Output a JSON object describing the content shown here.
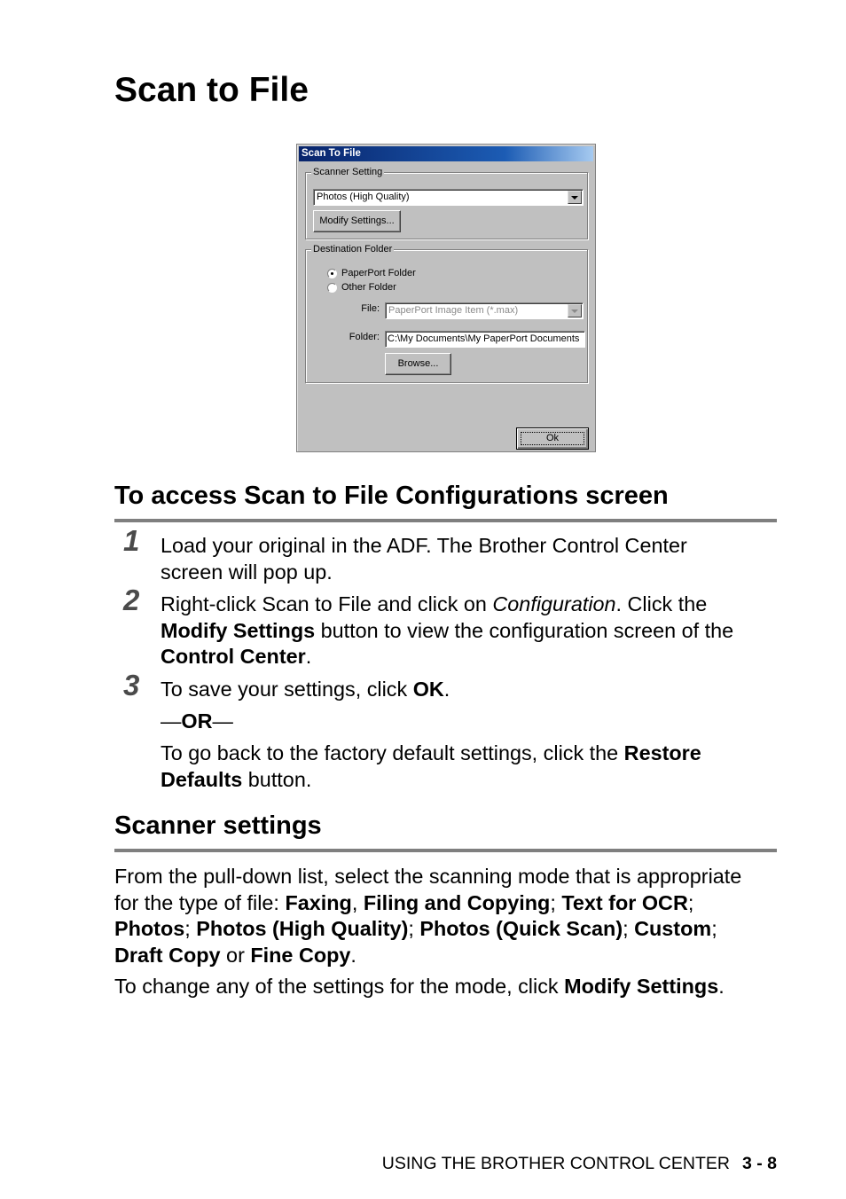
{
  "page_title": "Scan to File",
  "dialog": {
    "title": "Scan To File",
    "scanner_setting": {
      "legend": "Scanner Setting",
      "mode_selected": "Photos (High Quality)",
      "modify_button": "Modify Settings..."
    },
    "destination_folder": {
      "legend": "Destination Folder",
      "radio_paperport": "PaperPort Folder",
      "radio_other": "Other Folder",
      "selected_radio": "PaperPort Folder",
      "file_label": "File:",
      "file_value": "PaperPort Image Item (*.max)",
      "folder_label": "Folder:",
      "folder_value": "C:\\My Documents\\My PaperPort Documents",
      "browse_button": "Browse..."
    },
    "ok_button": "Ok"
  },
  "section_access": {
    "heading": "To access Scan to File Configurations screen",
    "steps": [
      {
        "number": "1",
        "line1": "Load your original in the ADF. The Brother Control Center",
        "line2": "screen will pop up."
      },
      {
        "number": "2",
        "line1_a": "Right-click Scan to File and click on ",
        "line1_italic": "Configuration",
        "line1_b": ". Click the",
        "line2_bold": "Modify Settings",
        "line2_rest": " button to view the configuration screen of the",
        "line3_bold": "Control Center",
        "line3_rest": "."
      },
      {
        "number": "3",
        "line1_a": "To save your settings, click ",
        "line1_bold": "OK",
        "line1_b": ".",
        "or_prefix": "—",
        "or_bold": "OR",
        "or_suffix": "—",
        "alt_a": "To go back to the factory default settings, click the ",
        "alt_bold1": "Restore",
        "alt_bold2": "Defaults",
        "alt_b": " button."
      }
    ]
  },
  "section_scanner": {
    "heading": "Scanner settings",
    "p1_line1": "From the pull-down list, select the scanning mode that is appropriate",
    "p1_line2_a": "for the type of file: ",
    "modes": [
      "Faxing",
      "Filing and Copying",
      "Text for OCR",
      "Photos",
      "Photos (High Quality)",
      "Photos (Quick Scan)",
      "Custom",
      "Draft Copy",
      "Fine Copy"
    ],
    "sep_comma": ", ",
    "sep_semi": "; ",
    "semi": ";",
    "or_word": " or ",
    "period": ".",
    "p2_a": "To change any of the settings for the mode, click ",
    "p2_bold": "Modify Settings",
    "p2_b": "."
  },
  "footer": {
    "chapter": "USING THE BROTHER CONTROL CENTER",
    "page_number": "3 - 8"
  }
}
